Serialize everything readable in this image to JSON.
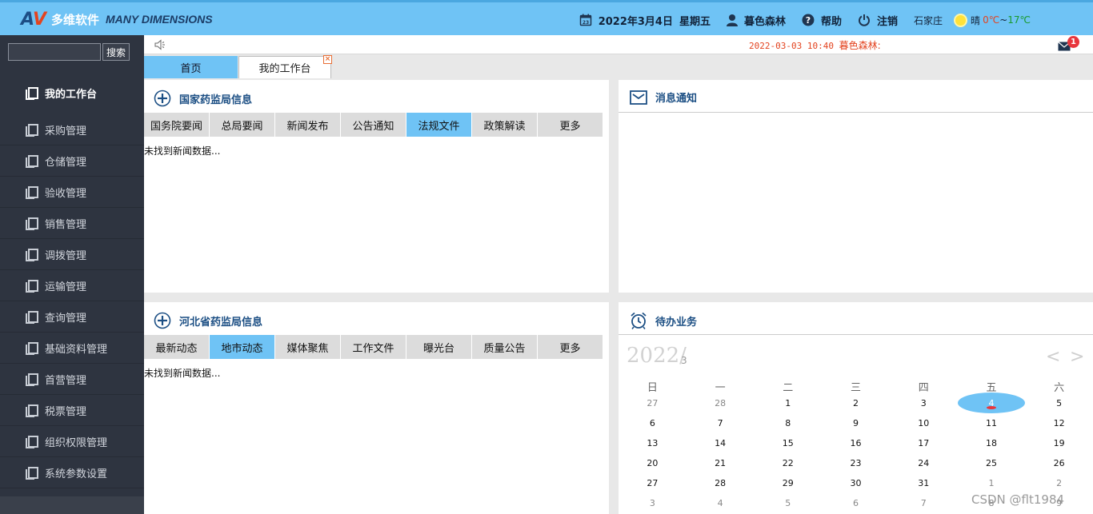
{
  "header": {
    "brand_cn": "多维软件",
    "brand_en": "MANY DIMENSIONS",
    "date": "2022年3月4日",
    "weekday": "星期五",
    "calendar_icon_day": "23",
    "user": "暮色森林",
    "help": "帮助",
    "logout": "注销",
    "city": "石家庄",
    "weather": "晴",
    "temp_low": "0℃",
    "temp_sep": "~",
    "temp_high": "17℃"
  },
  "sidebar": {
    "search_placeholder": "",
    "search_button": "搜索",
    "current": "我的工作台",
    "items": [
      {
        "label": "采购管理"
      },
      {
        "label": "仓储管理"
      },
      {
        "label": "验收管理"
      },
      {
        "label": "销售管理"
      },
      {
        "label": "调拨管理"
      },
      {
        "label": "运输管理"
      },
      {
        "label": "查询管理"
      },
      {
        "label": "基础资料管理"
      },
      {
        "label": "首营管理"
      },
      {
        "label": "税票管理"
      },
      {
        "label": "组织权限管理"
      },
      {
        "label": "系统参数设置"
      }
    ]
  },
  "notice": {
    "time": "2022-03-03 10:40",
    "user": "暮色森林:",
    "mail_count": "1"
  },
  "tabs": {
    "home": "首页",
    "workbench": "我的工作台",
    "close": "×"
  },
  "panels": {
    "national": {
      "title": "国家药监局信息",
      "tabs": [
        "国务院要闻",
        "总局要闻",
        "新闻发布",
        "公告通知",
        "法规文件",
        "政策解读",
        "更多"
      ],
      "active_tab": 4,
      "empty": "未找到新闻数据..."
    },
    "messages": {
      "title": "消息通知"
    },
    "hebei": {
      "title": "河北省药监局信息",
      "tabs": [
        "最新动态",
        "地市动态",
        "媒体聚焦",
        "工作文件",
        "曝光台",
        "质量公告",
        "更多"
      ],
      "active_tab": 1,
      "empty": "未找到新闻数据..."
    },
    "todo": {
      "title": "待办业务",
      "year": "2022/",
      "month": "3",
      "prev": "<",
      "next": ">",
      "weekdays": [
        "日",
        "一",
        "二",
        "三",
        "四",
        "五",
        "六"
      ],
      "weeks": [
        [
          {
            "d": "27",
            "o": true
          },
          {
            "d": "28",
            "o": true
          },
          {
            "d": "1"
          },
          {
            "d": "2"
          },
          {
            "d": "3"
          },
          {
            "d": "4",
            "today": true
          },
          {
            "d": "5"
          }
        ],
        [
          {
            "d": "6"
          },
          {
            "d": "7"
          },
          {
            "d": "8"
          },
          {
            "d": "9"
          },
          {
            "d": "10"
          },
          {
            "d": "11"
          },
          {
            "d": "12"
          }
        ],
        [
          {
            "d": "13"
          },
          {
            "d": "14"
          },
          {
            "d": "15"
          },
          {
            "d": "16"
          },
          {
            "d": "17"
          },
          {
            "d": "18"
          },
          {
            "d": "19"
          }
        ],
        [
          {
            "d": "20"
          },
          {
            "d": "21"
          },
          {
            "d": "22"
          },
          {
            "d": "23"
          },
          {
            "d": "24"
          },
          {
            "d": "25"
          },
          {
            "d": "26"
          }
        ],
        [
          {
            "d": "27"
          },
          {
            "d": "28"
          },
          {
            "d": "29"
          },
          {
            "d": "30"
          },
          {
            "d": "31"
          },
          {
            "d": "1",
            "o": true
          },
          {
            "d": "2",
            "o": true
          }
        ],
        [
          {
            "d": "3",
            "o": true
          },
          {
            "d": "4",
            "o": true
          },
          {
            "d": "5",
            "o": true
          },
          {
            "d": "6",
            "o": true
          },
          {
            "d": "7",
            "o": true
          },
          {
            "d": "8",
            "o": true
          },
          {
            "d": "9",
            "o": true
          }
        ]
      ]
    }
  },
  "watermark": "CSDN @flt1984",
  "colors": {
    "header_bg": "#6fc3f5",
    "sidebar_bg": "#2e3440",
    "active_tab": "#6fc3f5",
    "title_blue": "#1c4f84",
    "notice_red": "#e3431f"
  }
}
